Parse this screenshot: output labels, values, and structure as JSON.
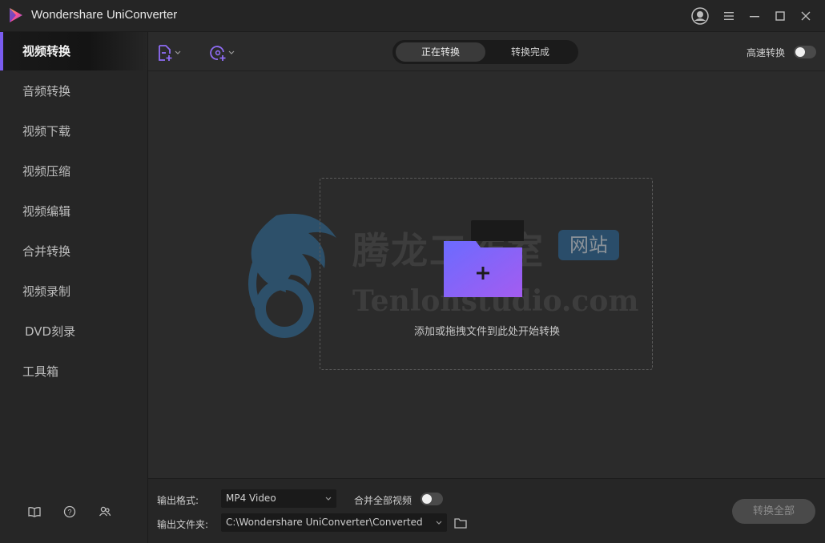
{
  "window": {
    "title": "Wondershare UniConverter"
  },
  "sidebar": {
    "items": [
      {
        "label": "视频转换",
        "active": true
      },
      {
        "label": "音频转换",
        "active": false
      },
      {
        "label": "视频下载",
        "active": false
      },
      {
        "label": "视频压缩",
        "active": false
      },
      {
        "label": "视频编辑",
        "active": false
      },
      {
        "label": "合并转换",
        "active": false
      },
      {
        "label": "视频录制",
        "active": false
      },
      {
        "label": "DVD刻录",
        "active": false
      },
      {
        "label": "工具箱",
        "active": false
      }
    ],
    "bottom_icons": [
      "book-icon",
      "help-icon",
      "users-icon"
    ]
  },
  "toolbar": {
    "add_file_icon": "add-file-icon",
    "add_disc_icon": "add-disc-icon",
    "tabs": [
      {
        "label": "正在转换",
        "active": true
      },
      {
        "label": "转换完成",
        "active": false
      }
    ],
    "high_speed_label": "高速转换",
    "high_speed_on": false
  },
  "dropzone": {
    "hint": "添加或拖拽文件到此处开始转换"
  },
  "watermark": {
    "cn_text": "腾龙工作室",
    "badge_text": "网站",
    "en_text": "Tenlonstudio.com"
  },
  "bottom": {
    "output_format_label": "输出格式:",
    "output_format_value": "MP4 Video",
    "merge_label": "合并全部视频",
    "merge_on": false,
    "output_folder_label": "输出文件夹:",
    "output_folder_value": "C:\\Wondershare UniConverter\\Converted",
    "convert_all_label": "转换全部"
  },
  "colors": {
    "accent": "#7a5cf0",
    "background": "#2b2b2b",
    "sidebar": "#262626",
    "folder_gradient_start": "#6b6bff",
    "folder_gradient_end": "#a45cf0"
  }
}
